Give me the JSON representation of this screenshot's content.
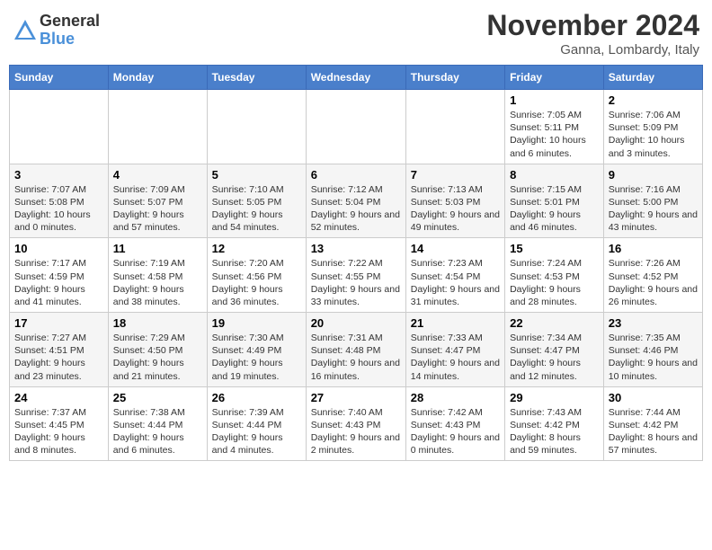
{
  "logo": {
    "general": "General",
    "blue": "Blue"
  },
  "header": {
    "month": "November 2024",
    "location": "Ganna, Lombardy, Italy"
  },
  "weekdays": [
    "Sunday",
    "Monday",
    "Tuesday",
    "Wednesday",
    "Thursday",
    "Friday",
    "Saturday"
  ],
  "weeks": [
    [
      {
        "day": "",
        "info": ""
      },
      {
        "day": "",
        "info": ""
      },
      {
        "day": "",
        "info": ""
      },
      {
        "day": "",
        "info": ""
      },
      {
        "day": "",
        "info": ""
      },
      {
        "day": "1",
        "info": "Sunrise: 7:05 AM\nSunset: 5:11 PM\nDaylight: 10 hours and 6 minutes."
      },
      {
        "day": "2",
        "info": "Sunrise: 7:06 AM\nSunset: 5:09 PM\nDaylight: 10 hours and 3 minutes."
      }
    ],
    [
      {
        "day": "3",
        "info": "Sunrise: 7:07 AM\nSunset: 5:08 PM\nDaylight: 10 hours and 0 minutes."
      },
      {
        "day": "4",
        "info": "Sunrise: 7:09 AM\nSunset: 5:07 PM\nDaylight: 9 hours and 57 minutes."
      },
      {
        "day": "5",
        "info": "Sunrise: 7:10 AM\nSunset: 5:05 PM\nDaylight: 9 hours and 54 minutes."
      },
      {
        "day": "6",
        "info": "Sunrise: 7:12 AM\nSunset: 5:04 PM\nDaylight: 9 hours and 52 minutes."
      },
      {
        "day": "7",
        "info": "Sunrise: 7:13 AM\nSunset: 5:03 PM\nDaylight: 9 hours and 49 minutes."
      },
      {
        "day": "8",
        "info": "Sunrise: 7:15 AM\nSunset: 5:01 PM\nDaylight: 9 hours and 46 minutes."
      },
      {
        "day": "9",
        "info": "Sunrise: 7:16 AM\nSunset: 5:00 PM\nDaylight: 9 hours and 43 minutes."
      }
    ],
    [
      {
        "day": "10",
        "info": "Sunrise: 7:17 AM\nSunset: 4:59 PM\nDaylight: 9 hours and 41 minutes."
      },
      {
        "day": "11",
        "info": "Sunrise: 7:19 AM\nSunset: 4:58 PM\nDaylight: 9 hours and 38 minutes."
      },
      {
        "day": "12",
        "info": "Sunrise: 7:20 AM\nSunset: 4:56 PM\nDaylight: 9 hours and 36 minutes."
      },
      {
        "day": "13",
        "info": "Sunrise: 7:22 AM\nSunset: 4:55 PM\nDaylight: 9 hours and 33 minutes."
      },
      {
        "day": "14",
        "info": "Sunrise: 7:23 AM\nSunset: 4:54 PM\nDaylight: 9 hours and 31 minutes."
      },
      {
        "day": "15",
        "info": "Sunrise: 7:24 AM\nSunset: 4:53 PM\nDaylight: 9 hours and 28 minutes."
      },
      {
        "day": "16",
        "info": "Sunrise: 7:26 AM\nSunset: 4:52 PM\nDaylight: 9 hours and 26 minutes."
      }
    ],
    [
      {
        "day": "17",
        "info": "Sunrise: 7:27 AM\nSunset: 4:51 PM\nDaylight: 9 hours and 23 minutes."
      },
      {
        "day": "18",
        "info": "Sunrise: 7:29 AM\nSunset: 4:50 PM\nDaylight: 9 hours and 21 minutes."
      },
      {
        "day": "19",
        "info": "Sunrise: 7:30 AM\nSunset: 4:49 PM\nDaylight: 9 hours and 19 minutes."
      },
      {
        "day": "20",
        "info": "Sunrise: 7:31 AM\nSunset: 4:48 PM\nDaylight: 9 hours and 16 minutes."
      },
      {
        "day": "21",
        "info": "Sunrise: 7:33 AM\nSunset: 4:47 PM\nDaylight: 9 hours and 14 minutes."
      },
      {
        "day": "22",
        "info": "Sunrise: 7:34 AM\nSunset: 4:47 PM\nDaylight: 9 hours and 12 minutes."
      },
      {
        "day": "23",
        "info": "Sunrise: 7:35 AM\nSunset: 4:46 PM\nDaylight: 9 hours and 10 minutes."
      }
    ],
    [
      {
        "day": "24",
        "info": "Sunrise: 7:37 AM\nSunset: 4:45 PM\nDaylight: 9 hours and 8 minutes."
      },
      {
        "day": "25",
        "info": "Sunrise: 7:38 AM\nSunset: 4:44 PM\nDaylight: 9 hours and 6 minutes."
      },
      {
        "day": "26",
        "info": "Sunrise: 7:39 AM\nSunset: 4:44 PM\nDaylight: 9 hours and 4 minutes."
      },
      {
        "day": "27",
        "info": "Sunrise: 7:40 AM\nSunset: 4:43 PM\nDaylight: 9 hours and 2 minutes."
      },
      {
        "day": "28",
        "info": "Sunrise: 7:42 AM\nSunset: 4:43 PM\nDaylight: 9 hours and 0 minutes."
      },
      {
        "day": "29",
        "info": "Sunrise: 7:43 AM\nSunset: 4:42 PM\nDaylight: 8 hours and 59 minutes."
      },
      {
        "day": "30",
        "info": "Sunrise: 7:44 AM\nSunset: 4:42 PM\nDaylight: 8 hours and 57 minutes."
      }
    ]
  ]
}
